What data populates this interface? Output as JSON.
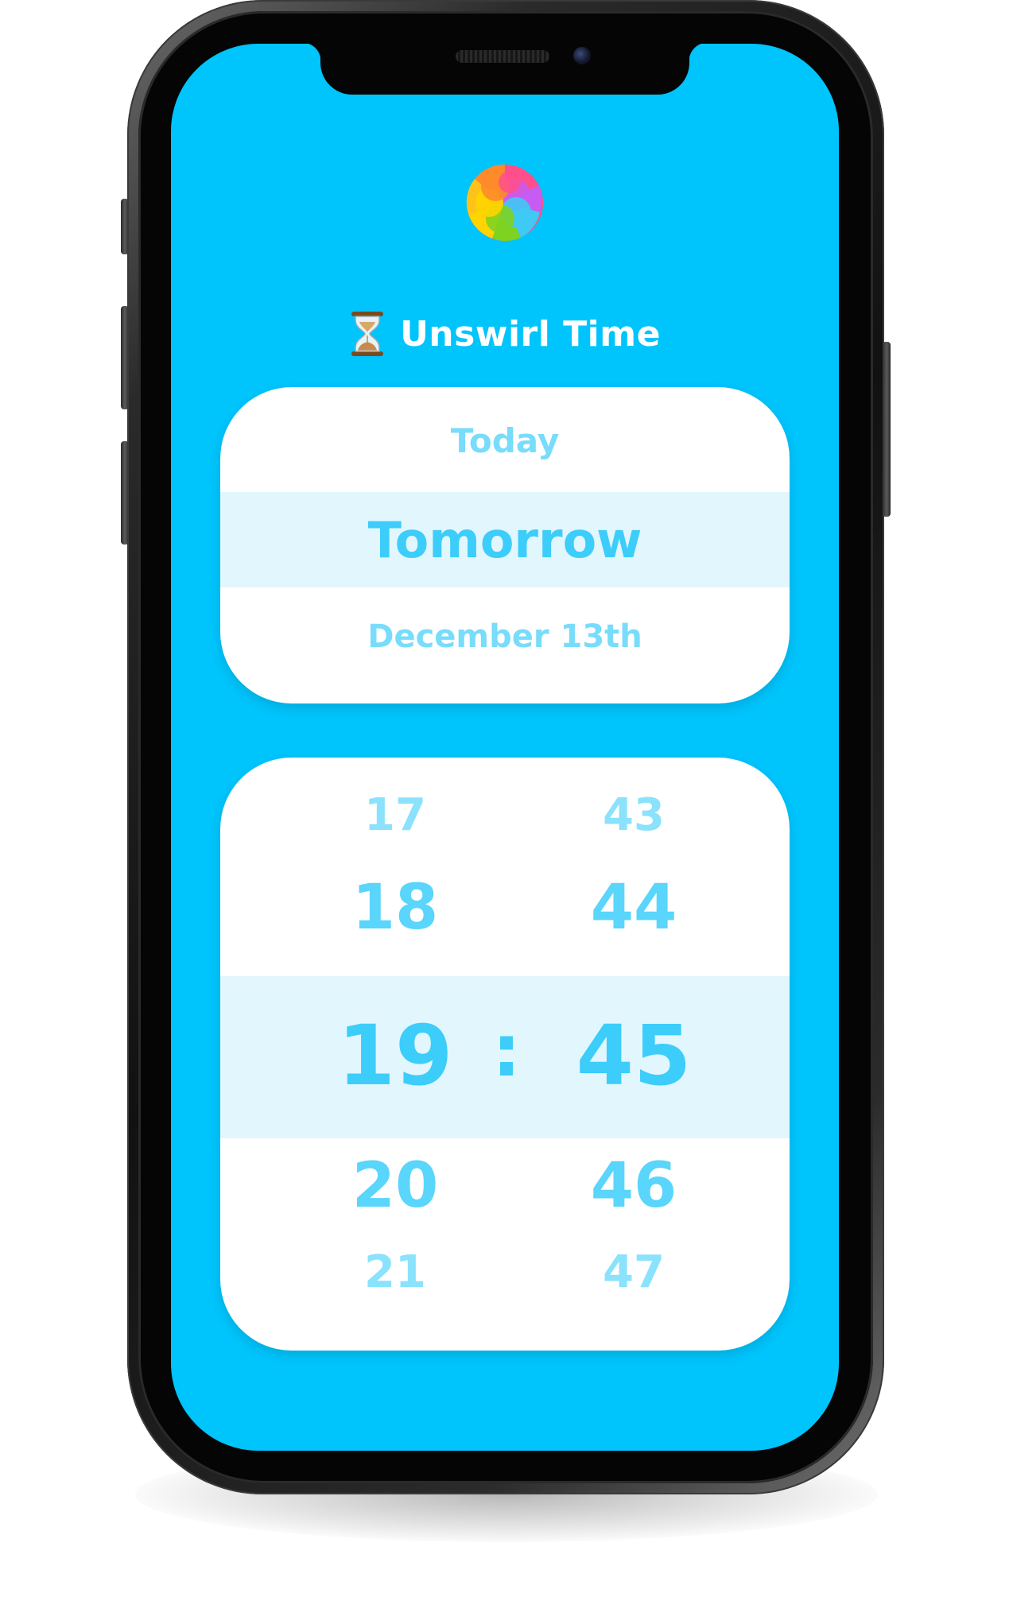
{
  "app": {
    "title": "Unswirl Time",
    "logo_icon": "swirl-logo-icon",
    "title_icon": "hourglass-icon"
  },
  "date_picker": {
    "previous": "Today",
    "selected": "Tomorrow",
    "next": "December 13th"
  },
  "time_picker": {
    "hours": [
      "17",
      "18",
      "19",
      "20",
      "21"
    ],
    "minutes": [
      "43",
      "44",
      "45",
      "46",
      "47"
    ],
    "selected_hour": "19",
    "selected_minute": "45",
    "separator": ":"
  },
  "colors": {
    "screen_background": "#00c4fc",
    "card_background": "#ffffff",
    "selection_band": "#e2f6fd",
    "text_accent": "#3ccdfa"
  }
}
